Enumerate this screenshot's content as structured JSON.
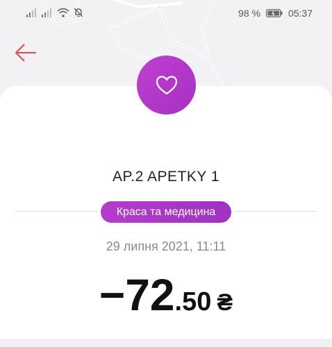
{
  "status_bar": {
    "battery_percent": "98 %",
    "time": "05:37",
    "icons": [
      "signal-icon",
      "signal-icon",
      "wifi-icon",
      "bell-off-icon",
      "battery-icon"
    ]
  },
  "header": {
    "back_icon": "arrow-left-icon"
  },
  "transaction": {
    "category_icon": "heart-icon",
    "merchant": "AP.2 APETKY 1",
    "category": "Краса та медицина",
    "datetime": "29 липня 2021, 11:11",
    "amount_main": "−72",
    "amount_cents": ".50",
    "currency": "₴"
  },
  "colors": {
    "accent": "#b03ac8",
    "back_arrow": "#e5484d"
  }
}
